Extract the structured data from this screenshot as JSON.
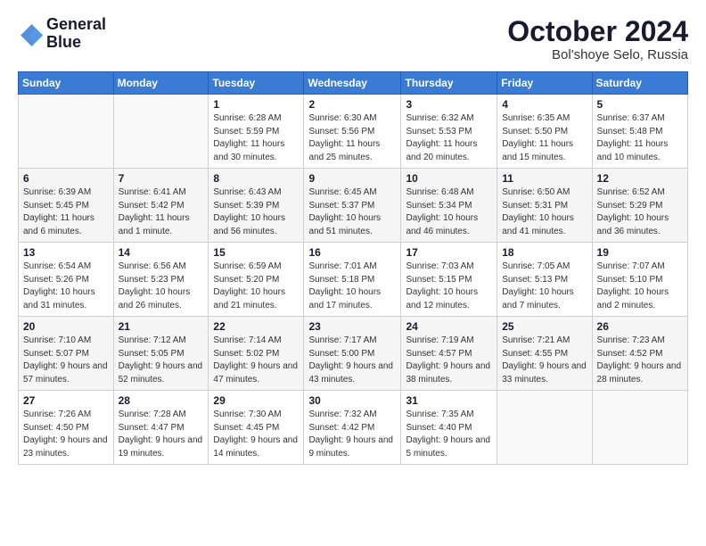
{
  "logo": {
    "line1": "General",
    "line2": "Blue"
  },
  "title": "October 2024",
  "subtitle": "Bol'shoye Selo, Russia",
  "days_of_week": [
    "Sunday",
    "Monday",
    "Tuesday",
    "Wednesday",
    "Thursday",
    "Friday",
    "Saturday"
  ],
  "weeks": [
    [
      {
        "day": "",
        "info": ""
      },
      {
        "day": "",
        "info": ""
      },
      {
        "day": "1",
        "info": "Sunrise: 6:28 AM\nSunset: 5:59 PM\nDaylight: 11 hours\nand 30 minutes."
      },
      {
        "day": "2",
        "info": "Sunrise: 6:30 AM\nSunset: 5:56 PM\nDaylight: 11 hours\nand 25 minutes."
      },
      {
        "day": "3",
        "info": "Sunrise: 6:32 AM\nSunset: 5:53 PM\nDaylight: 11 hours\nand 20 minutes."
      },
      {
        "day": "4",
        "info": "Sunrise: 6:35 AM\nSunset: 5:50 PM\nDaylight: 11 hours\nand 15 minutes."
      },
      {
        "day": "5",
        "info": "Sunrise: 6:37 AM\nSunset: 5:48 PM\nDaylight: 11 hours\nand 10 minutes."
      }
    ],
    [
      {
        "day": "6",
        "info": "Sunrise: 6:39 AM\nSunset: 5:45 PM\nDaylight: 11 hours\nand 6 minutes."
      },
      {
        "day": "7",
        "info": "Sunrise: 6:41 AM\nSunset: 5:42 PM\nDaylight: 11 hours\nand 1 minute."
      },
      {
        "day": "8",
        "info": "Sunrise: 6:43 AM\nSunset: 5:39 PM\nDaylight: 10 hours\nand 56 minutes."
      },
      {
        "day": "9",
        "info": "Sunrise: 6:45 AM\nSunset: 5:37 PM\nDaylight: 10 hours\nand 51 minutes."
      },
      {
        "day": "10",
        "info": "Sunrise: 6:48 AM\nSunset: 5:34 PM\nDaylight: 10 hours\nand 46 minutes."
      },
      {
        "day": "11",
        "info": "Sunrise: 6:50 AM\nSunset: 5:31 PM\nDaylight: 10 hours\nand 41 minutes."
      },
      {
        "day": "12",
        "info": "Sunrise: 6:52 AM\nSunset: 5:29 PM\nDaylight: 10 hours\nand 36 minutes."
      }
    ],
    [
      {
        "day": "13",
        "info": "Sunrise: 6:54 AM\nSunset: 5:26 PM\nDaylight: 10 hours\nand 31 minutes."
      },
      {
        "day": "14",
        "info": "Sunrise: 6:56 AM\nSunset: 5:23 PM\nDaylight: 10 hours\nand 26 minutes."
      },
      {
        "day": "15",
        "info": "Sunrise: 6:59 AM\nSunset: 5:20 PM\nDaylight: 10 hours\nand 21 minutes."
      },
      {
        "day": "16",
        "info": "Sunrise: 7:01 AM\nSunset: 5:18 PM\nDaylight: 10 hours\nand 17 minutes."
      },
      {
        "day": "17",
        "info": "Sunrise: 7:03 AM\nSunset: 5:15 PM\nDaylight: 10 hours\nand 12 minutes."
      },
      {
        "day": "18",
        "info": "Sunrise: 7:05 AM\nSunset: 5:13 PM\nDaylight: 10 hours\nand 7 minutes."
      },
      {
        "day": "19",
        "info": "Sunrise: 7:07 AM\nSunset: 5:10 PM\nDaylight: 10 hours\nand 2 minutes."
      }
    ],
    [
      {
        "day": "20",
        "info": "Sunrise: 7:10 AM\nSunset: 5:07 PM\nDaylight: 9 hours\nand 57 minutes."
      },
      {
        "day": "21",
        "info": "Sunrise: 7:12 AM\nSunset: 5:05 PM\nDaylight: 9 hours\nand 52 minutes."
      },
      {
        "day": "22",
        "info": "Sunrise: 7:14 AM\nSunset: 5:02 PM\nDaylight: 9 hours\nand 47 minutes."
      },
      {
        "day": "23",
        "info": "Sunrise: 7:17 AM\nSunset: 5:00 PM\nDaylight: 9 hours\nand 43 minutes."
      },
      {
        "day": "24",
        "info": "Sunrise: 7:19 AM\nSunset: 4:57 PM\nDaylight: 9 hours\nand 38 minutes."
      },
      {
        "day": "25",
        "info": "Sunrise: 7:21 AM\nSunset: 4:55 PM\nDaylight: 9 hours\nand 33 minutes."
      },
      {
        "day": "26",
        "info": "Sunrise: 7:23 AM\nSunset: 4:52 PM\nDaylight: 9 hours\nand 28 minutes."
      }
    ],
    [
      {
        "day": "27",
        "info": "Sunrise: 7:26 AM\nSunset: 4:50 PM\nDaylight: 9 hours\nand 23 minutes."
      },
      {
        "day": "28",
        "info": "Sunrise: 7:28 AM\nSunset: 4:47 PM\nDaylight: 9 hours\nand 19 minutes."
      },
      {
        "day": "29",
        "info": "Sunrise: 7:30 AM\nSunset: 4:45 PM\nDaylight: 9 hours\nand 14 minutes."
      },
      {
        "day": "30",
        "info": "Sunrise: 7:32 AM\nSunset: 4:42 PM\nDaylight: 9 hours\nand 9 minutes."
      },
      {
        "day": "31",
        "info": "Sunrise: 7:35 AM\nSunset: 4:40 PM\nDaylight: 9 hours\nand 5 minutes."
      },
      {
        "day": "",
        "info": ""
      },
      {
        "day": "",
        "info": ""
      }
    ]
  ]
}
